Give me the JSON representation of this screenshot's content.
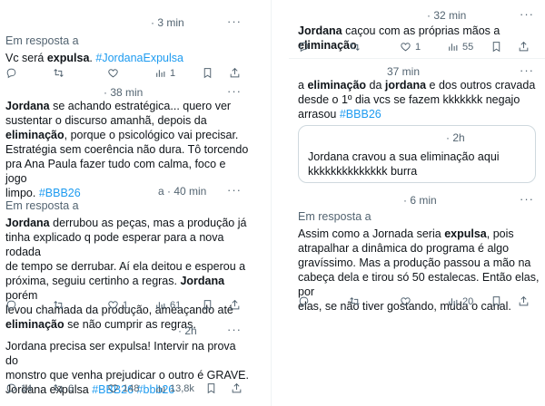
{
  "left": {
    "t1": {
      "time": "· 3 min",
      "reply_label": "Em resposta a",
      "text_plain": "Vc será ",
      "text_bold": "expulsa",
      "text_after": ". ",
      "tag": "#JordanaExpulsa",
      "views": "1"
    },
    "t2": {
      "time": "· 38 min",
      "l1_b": "Jordana",
      "l1_rest": " se achando estratégica... quero ver",
      "l2": "sustentar o discurso amanhã, depois da",
      "l3_b": "eliminação",
      "l3_rest": ", porque o psicológico vai precisar.",
      "l4": "Estratégia sem coerência não dura. Tô torcendo",
      "l5": "pra Ana Paula fazer tudo com calma, foco e jogo",
      "l6": "limpo. ",
      "l6_tag": "#BBB26"
    },
    "t3": {
      "time": "a · 40 min",
      "reply_label": "Em resposta a",
      "l1_b": "Jordana",
      "l1_rest": " derrubou as peças, mas a produção já",
      "l2": "tinha explicado q pode esperar para a nova rodada",
      "l3": "de tempo se derrubar. Aí ela deitou e esperou a",
      "l4_a": "próxima, seguiu certinho a regras. ",
      "l4_b": "Jordana",
      "l4_c": " porém",
      "l5": "levou chamada da produção, ameaçando até",
      "l6_b": "eliminação",
      "l6_rest": " se não cumprir as regras.",
      "likes": "1",
      "views": "61"
    },
    "t4": {
      "time": "· 2h",
      "l1": "Jordana precisa ser expulsa! Intervir na prova do",
      "l2": "monstro que venha prejudicar o outro é GRAVE.",
      "l3": "Jordana expulsa ",
      "tag1": "#BBB26",
      "tag2": " #bbb26",
      "replies": "14",
      "retweets": "6",
      "likes": "148",
      "views": "13,8k"
    }
  },
  "right": {
    "t1": {
      "time": "· 32 min",
      "b1": "Jordana",
      "mid": " caçou com as próprias mãos a ",
      "b2": "eliminação",
      "likes": "1",
      "views": "55"
    },
    "t2": {
      "time": "37 min",
      "l1_a": "a ",
      "l1_b": "eliminação",
      "l1_c": " da ",
      "l1_d": "jordana",
      "l1_e": " e dos outros cravada",
      "l2": "desde o 1º dia vcs se fazem kkkkkkk negajo",
      "l3": "arrasou ",
      "tag": "#BBB26",
      "quote_time": "· 2h",
      "quote_l1": "Jordana cravou a sua eliminação aqui",
      "quote_l2": "kkkkkkkkkkkkkk burra"
    },
    "t3": {
      "time": "· 6 min",
      "reply_label": "Em resposta a",
      "l1_a": "Assim como a Jornada seria ",
      "l1_b": "expulsa",
      "l1_c": ", pois",
      "l2": "atrapalhar a dinâmica do programa é algo",
      "l3": "gravíssimo. Mas a produção passou a mão na",
      "l4": "cabeça dela e tirou só 50 estalecas. Então elas, por",
      "l5": "elas, se não tiver gostando, muda o canal.",
      "views": "20"
    }
  },
  "icons": [
    "reply-icon",
    "retweet-icon",
    "like-icon",
    "views-icon",
    "bookmark-icon",
    "share-icon",
    "more-icon"
  ],
  "colors": {
    "text": "#0f1419",
    "muted": "#536471",
    "link": "#1d9bf0",
    "border": "#cfd9de"
  }
}
